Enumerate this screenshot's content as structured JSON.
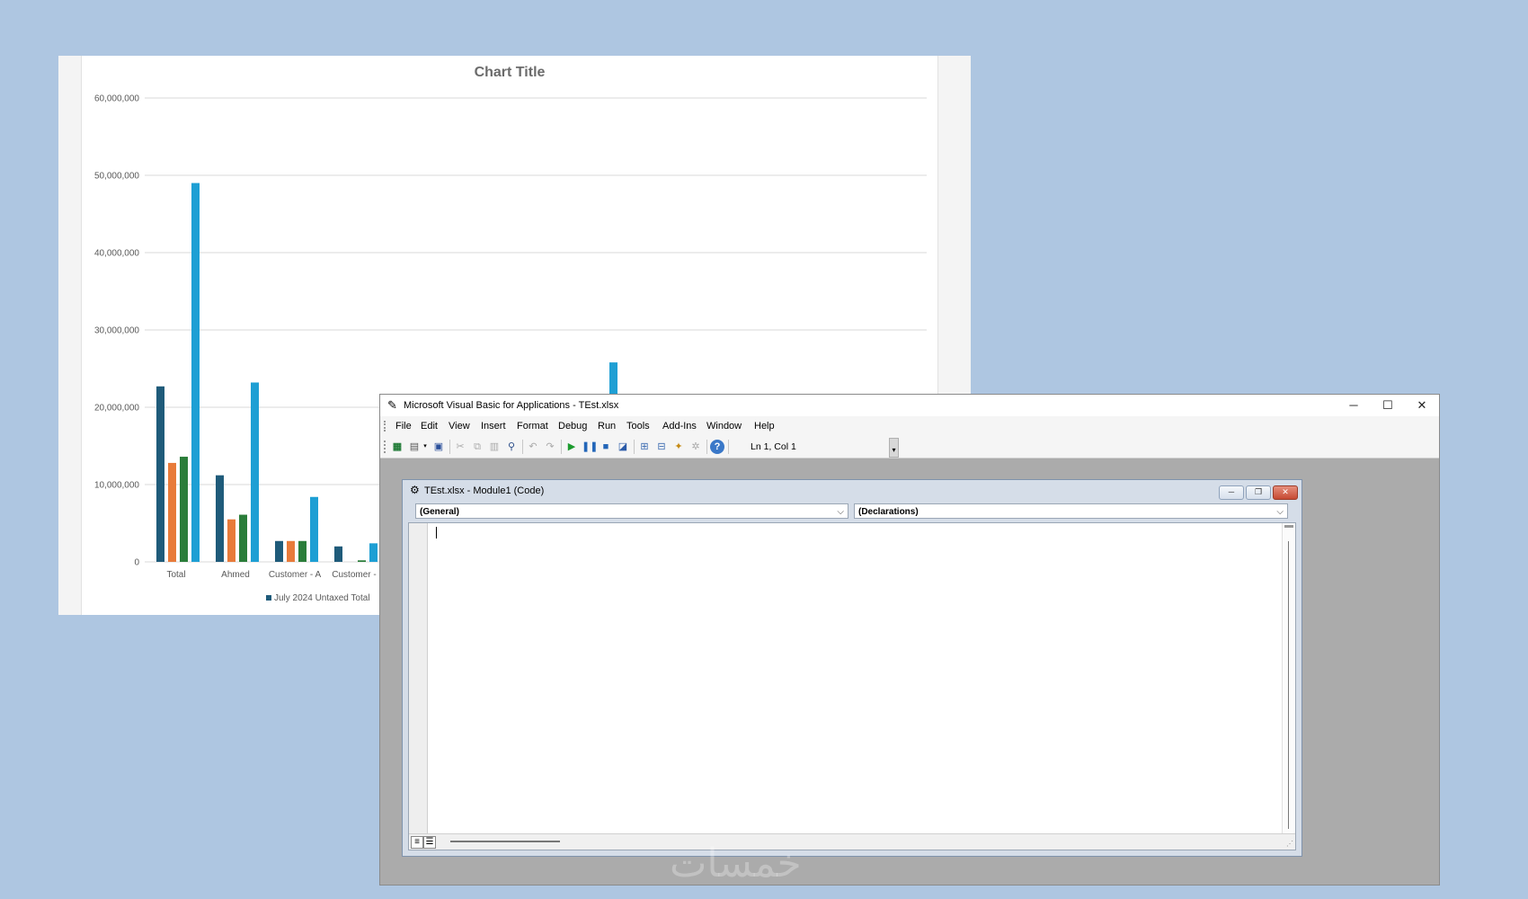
{
  "chart_data": {
    "type": "bar",
    "title": "Chart Title",
    "categories": [
      "Total",
      "Ahmed",
      "Customer - A",
      "Customer - "
    ],
    "series": [
      {
        "name": "July 2024 Untaxed Total",
        "color": "#1f5b7a",
        "values": [
          22700000,
          11200000,
          2700000,
          2000000
        ]
      },
      {
        "name": "",
        "color": "#e87b3a",
        "values": [
          12800000,
          5500000,
          2700000,
          0
        ]
      },
      {
        "name": "",
        "color": "#2a7d3a",
        "values": [
          13600000,
          6100000,
          2700000,
          200000
        ]
      },
      {
        "name": "",
        "color": "#1e9fd4",
        "values": [
          49000000,
          23200000,
          8400000,
          2400000
        ]
      }
    ],
    "extra_bar": {
      "color": "#1e9fd4",
      "value": 25800000
    },
    "yticks": [
      "0",
      "10,000,000",
      "20,000,000",
      "30,000,000",
      "40,000,000",
      "50,000,000",
      "60,000,000"
    ],
    "ylim": [
      0,
      60000000
    ],
    "grid": true,
    "legend": "bottom"
  },
  "vba": {
    "title": "Microsoft Visual Basic for Applications - TEst.xlsx",
    "menu": [
      "File",
      "Edit",
      "View",
      "Insert",
      "Format",
      "Debug",
      "Run",
      "Tools",
      "Add-Ins",
      "Window",
      "Help"
    ],
    "status": "Ln 1, Col 1",
    "code_window": {
      "title": "TEst.xlsx - Module1 (Code)",
      "object_combo": "(General)",
      "procedure_combo": "(Declarations)"
    }
  },
  "watermark": "خمسات"
}
